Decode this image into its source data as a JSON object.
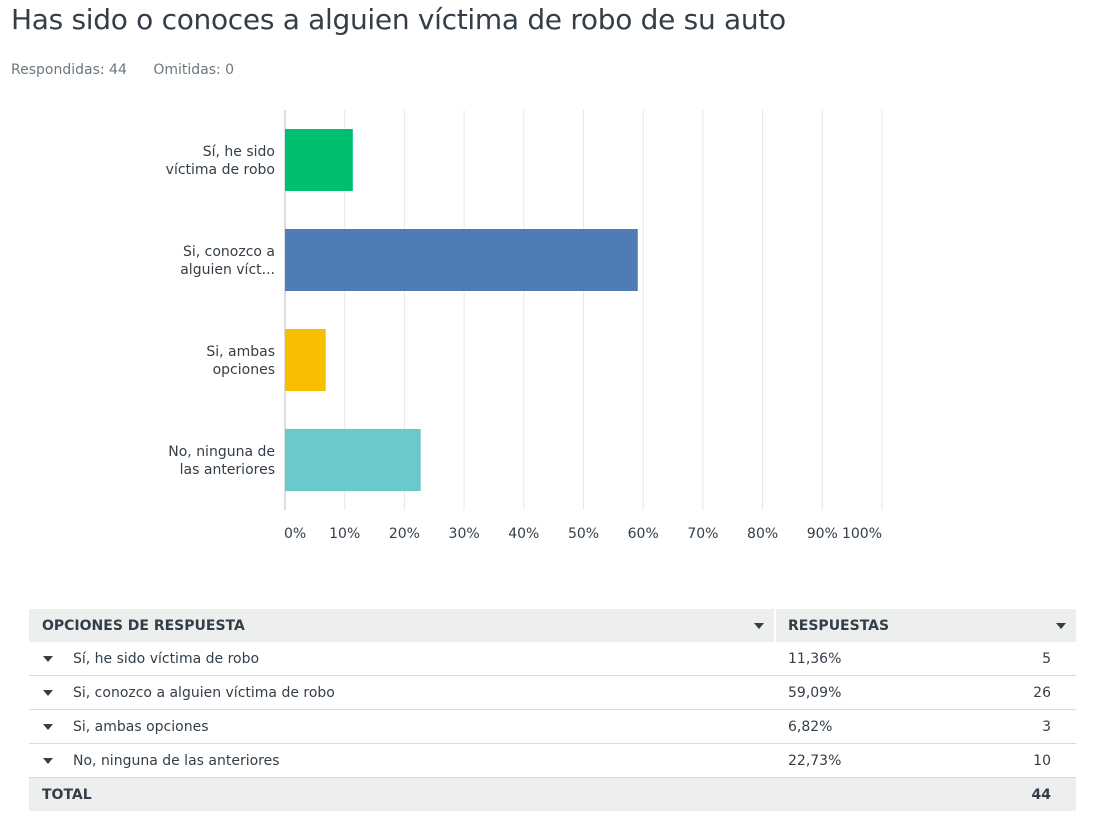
{
  "question": {
    "title": "Has sido o conoces a alguien víctima de robo de su auto",
    "answered_label": "Respondidas: 44",
    "skipped_label": "Omitidas: 0"
  },
  "chart_data": {
    "type": "bar",
    "orientation": "horizontal",
    "categories": [
      [
        "Sí, he sido",
        "víctima de robo"
      ],
      [
        "Si, conozco a",
        "alguien víct..."
      ],
      [
        "Si, ambas",
        "opciones"
      ],
      [
        "No, ninguna de",
        "las anteriores"
      ]
    ],
    "values": [
      11.36,
      59.09,
      6.82,
      22.73
    ],
    "colors": [
      "#00bf6f",
      "#507cb6",
      "#f9be00",
      "#6bc8cd"
    ],
    "xlim": [
      0,
      100
    ],
    "ticks": [
      "0%",
      "10%",
      "20%",
      "30%",
      "40%",
      "50%",
      "60%",
      "70%",
      "80%",
      "90%",
      "100%"
    ],
    "grid": true
  },
  "table": {
    "header_options": "OPCIONES DE RESPUESTA",
    "header_responses": "RESPUESTAS",
    "rows": [
      {
        "label": "Sí, he sido víctima de robo",
        "pct": "11,36%",
        "count": "5"
      },
      {
        "label": "Si, conozco a alguien víctima de robo",
        "pct": "59,09%",
        "count": "26"
      },
      {
        "label": "Si, ambas opciones",
        "pct": "6,82%",
        "count": "3"
      },
      {
        "label": "No, ninguna de las anteriores",
        "pct": "22,73%",
        "count": "10"
      }
    ],
    "total_label": "TOTAL",
    "total_value": "44"
  }
}
